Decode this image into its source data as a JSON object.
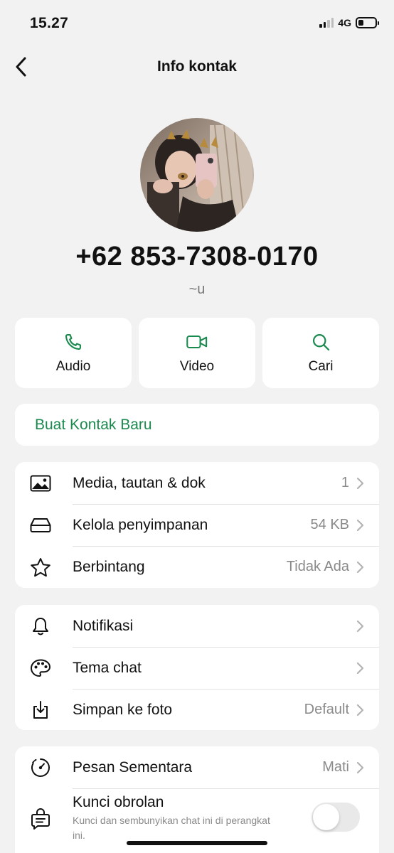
{
  "status_bar": {
    "time": "15.27",
    "network": "4G"
  },
  "header": {
    "title": "Info kontak"
  },
  "profile": {
    "phone": "+62 853-7308-0170",
    "push_name": "~u"
  },
  "quick_actions": [
    {
      "label": "Audio",
      "icon": "phone-icon"
    },
    {
      "label": "Video",
      "icon": "video-icon"
    },
    {
      "label": "Cari",
      "icon": "search-icon"
    }
  ],
  "create_contact": {
    "label": "Buat Kontak Baru"
  },
  "media_section": [
    {
      "label": "Media, tautan & dok",
      "value": "1",
      "icon": "image-icon"
    },
    {
      "label": "Kelola penyimpanan",
      "value": "54 KB",
      "icon": "storage-icon"
    },
    {
      "label": "Berbintang",
      "value": "Tidak Ada",
      "icon": "star-icon"
    }
  ],
  "notif_section": [
    {
      "label": "Notifikasi",
      "value": "",
      "icon": "bell-icon"
    },
    {
      "label": "Tema chat",
      "value": "",
      "icon": "palette-icon"
    },
    {
      "label": "Simpan ke foto",
      "value": "Default",
      "icon": "save-photo-icon"
    }
  ],
  "privacy_section": {
    "disappearing": {
      "label": "Pesan Sementara",
      "value": "Mati",
      "icon": "timer-icon"
    },
    "chat_lock": {
      "label": "Kunci obrolan",
      "subtitle": "Kunci dan sembunyikan chat ini di perangkat ini.",
      "enabled": false,
      "icon": "chat-lock-icon"
    }
  },
  "colors": {
    "accent": "#1a8a4e",
    "background": "#f2f2f2",
    "card": "#ffffff",
    "secondary_text": "#8a8a8a"
  }
}
